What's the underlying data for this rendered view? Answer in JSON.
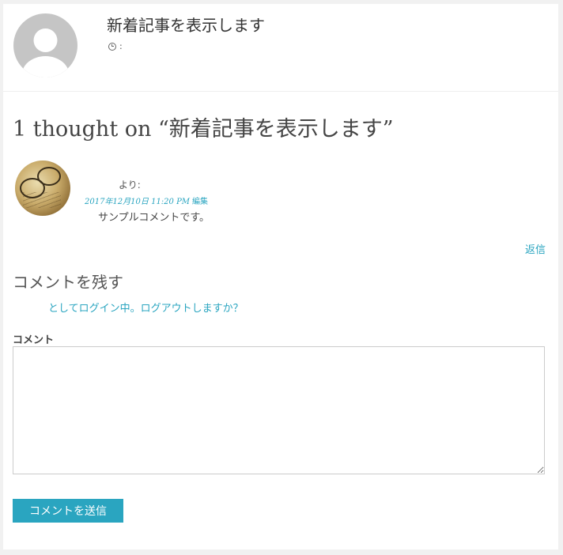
{
  "post": {
    "title": "新着記事を表示します",
    "meta_separator": ":"
  },
  "comments": {
    "heading": "1 thought on “新着記事を表示します”",
    "items": [
      {
        "author_suffix": "より:",
        "date": "2017年12月10日 11:20 PM",
        "edit_label": "編集",
        "text": "サンプルコメントです。",
        "reply_label": "返信"
      }
    ]
  },
  "respond": {
    "title": "コメントを残す",
    "logged_in_as": "としてログイン中。",
    "logout_label": "ログアウトしますか？",
    "comment_label": "コメント",
    "comment_value": "",
    "submit_label": "コメントを送信"
  },
  "colors": {
    "accent": "#2aa5c0",
    "text": "#444444",
    "background": "#ffffff"
  },
  "icons": {
    "post_meta": "clock-icon",
    "author_avatar": "default-avatar-icon"
  }
}
